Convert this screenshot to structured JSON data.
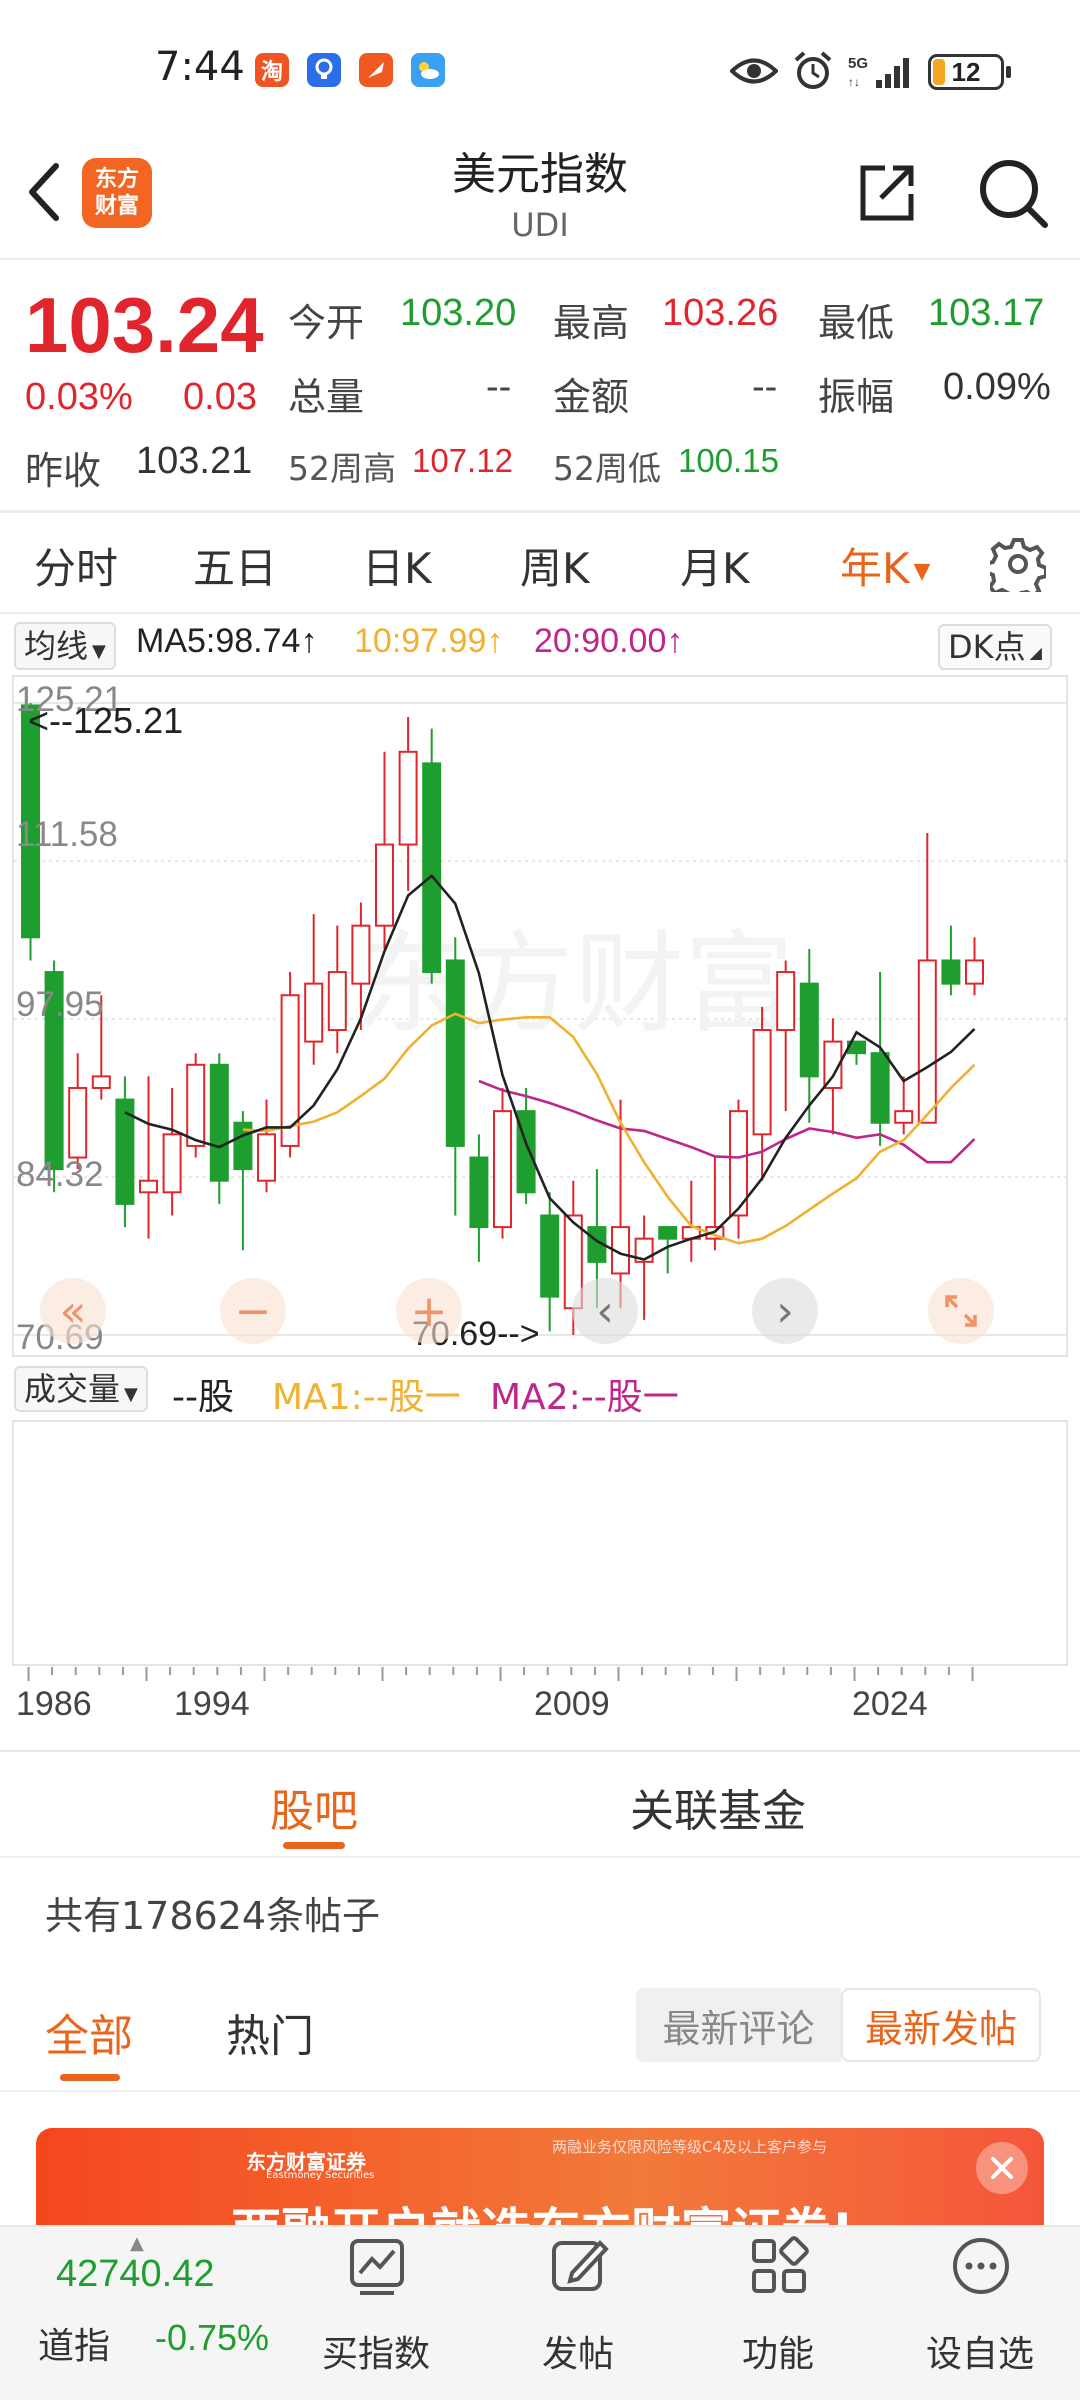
{
  "status_bar": {
    "time": "7:44",
    "network": "5G",
    "battery": "12",
    "icons": [
      "taobao-icon",
      "bulb-icon",
      "feather-icon",
      "weather-icon",
      "eye-icon",
      "alarm-icon",
      "signal-icon",
      "battery-icon"
    ]
  },
  "header": {
    "title": "美元指数",
    "subtitle": "UDI",
    "logo_text_1": "东方",
    "logo_text_2": "财富"
  },
  "quote": {
    "price": "103.24",
    "change_pct": "0.03%",
    "change": "0.03",
    "prev_close_label": "昨收",
    "prev_close": "103.21",
    "open_label": "今开",
    "open": "103.20",
    "high_label": "最高",
    "high": "103.26",
    "low_label": "最低",
    "low": "103.17",
    "volume_label": "总量",
    "volume": "--",
    "amount_label": "金额",
    "amount": "--",
    "amplitude_label": "振幅",
    "amplitude": "0.09%",
    "w52_high_label": "52周高",
    "w52_high": "107.12",
    "w52_low_label": "52周低",
    "w52_low": "100.15"
  },
  "period_tabs": [
    "分时",
    "五日",
    "日K",
    "周K",
    "月K",
    "年K"
  ],
  "active_period": "年K",
  "ma_bar": {
    "selector": "均线",
    "ma5": "MA5:98.74↑",
    "ma10": "10:97.99↑",
    "ma20": "20:90.00↑",
    "dk": "DK点"
  },
  "colors": {
    "up": "#e0262c",
    "down": "#1e9e2e",
    "ma5": "#222222",
    "ma10": "#f0b030",
    "ma20": "#c0268a",
    "accent": "#e8661c"
  },
  "chart_data": {
    "type": "candlestick",
    "y_ticks": [
      "125.21",
      "111.58",
      "97.95",
      "84.32",
      "70.69"
    ],
    "ylim": [
      70.69,
      125.21
    ],
    "x_ticks": [
      "1986",
      "1994",
      "2009",
      "2024"
    ],
    "max_label": "<--125.21",
    "min_label": "70.69-->",
    "candles": [
      {
        "o": 125,
        "c": 105,
        "h": 125.21,
        "l": 103
      },
      {
        "o": 102,
        "c": 85,
        "h": 103,
        "l": 83
      },
      {
        "o": 86,
        "c": 92,
        "h": 95,
        "l": 85
      },
      {
        "o": 92,
        "c": 93,
        "h": 100,
        "l": 91
      },
      {
        "o": 91,
        "c": 82,
        "h": 93,
        "l": 80
      },
      {
        "o": 83,
        "c": 84,
        "h": 93,
        "l": 79
      },
      {
        "o": 83,
        "c": 88,
        "h": 92,
        "l": 81
      },
      {
        "o": 87,
        "c": 94,
        "h": 95,
        "l": 86
      },
      {
        "o": 94,
        "c": 84,
        "h": 95,
        "l": 82
      },
      {
        "o": 89,
        "c": 85,
        "h": 90,
        "l": 78
      },
      {
        "o": 84,
        "c": 88,
        "h": 91,
        "l": 83
      },
      {
        "o": 87,
        "c": 100,
        "h": 102,
        "l": 86
      },
      {
        "o": 96,
        "c": 101,
        "h": 107,
        "l": 94
      },
      {
        "o": 97,
        "c": 102,
        "h": 106,
        "l": 95
      },
      {
        "o": 101,
        "c": 106,
        "h": 108,
        "l": 97
      },
      {
        "o": 106,
        "c": 113,
        "h": 121,
        "l": 104
      },
      {
        "o": 113,
        "c": 121,
        "h": 124,
        "l": 109
      },
      {
        "o": 120,
        "c": 102,
        "h": 123,
        "l": 101
      },
      {
        "o": 103,
        "c": 87,
        "h": 105,
        "l": 81
      },
      {
        "o": 86,
        "c": 80,
        "h": 88,
        "l": 77
      },
      {
        "o": 80,
        "c": 90,
        "h": 92,
        "l": 79
      },
      {
        "o": 90,
        "c": 83,
        "h": 92,
        "l": 82
      },
      {
        "o": 81,
        "c": 74,
        "h": 83,
        "l": 71
      },
      {
        "o": 73,
        "c": 81,
        "h": 84,
        "l": 70.69
      },
      {
        "o": 80,
        "c": 77,
        "h": 85,
        "l": 73
      },
      {
        "o": 76,
        "c": 80,
        "h": 91,
        "l": 73
      },
      {
        "o": 77,
        "c": 79,
        "h": 81,
        "l": 72
      },
      {
        "o": 80,
        "c": 79,
        "h": 80,
        "l": 76
      },
      {
        "o": 79,
        "c": 80,
        "h": 84,
        "l": 77
      },
      {
        "o": 79,
        "c": 80,
        "h": 86,
        "l": 78
      },
      {
        "o": 81,
        "c": 90,
        "h": 91,
        "l": 79
      },
      {
        "o": 88,
        "c": 97,
        "h": 99,
        "l": 84
      },
      {
        "o": 97,
        "c": 102,
        "h": 103,
        "l": 90
      },
      {
        "o": 101,
        "c": 93,
        "h": 104,
        "l": 89
      },
      {
        "o": 92,
        "c": 96,
        "h": 98,
        "l": 88
      },
      {
        "o": 96,
        "c": 95,
        "h": 96,
        "l": 94
      },
      {
        "o": 95,
        "c": 89,
        "h": 102,
        "l": 87
      },
      {
        "o": 89,
        "c": 90,
        "h": 93,
        "l": 88
      },
      {
        "o": 89,
        "c": 103,
        "h": 114,
        "l": 89
      },
      {
        "o": 103,
        "c": 101,
        "h": 106,
        "l": 100
      },
      {
        "o": 101,
        "c": 103,
        "h": 105,
        "l": 100
      }
    ],
    "ma5": [
      null,
      null,
      null,
      null,
      89.9,
      88.9,
      88.4,
      87.5,
      86.9,
      87.9,
      88.6,
      88.6,
      90.5,
      93.6,
      98,
      103.8,
      108.6,
      110.3,
      107.9,
      101.9,
      93.1,
      87.2,
      82.5,
      80.4,
      78.8,
      77.7,
      77.2,
      78.3,
      79.0,
      79.6,
      81.6,
      84.2,
      87.7,
      90.5,
      93.0,
      96.8,
      95.5,
      92.6,
      93.8,
      95.1,
      97.1
    ],
    "ma10": [
      null,
      null,
      null,
      null,
      null,
      null,
      null,
      null,
      null,
      88.4,
      88.3,
      88.7,
      89.1,
      89.9,
      91.3,
      92.8,
      95.4,
      97.4,
      98.4,
      97.6,
      97.9,
      98.1,
      98.1,
      96.4,
      93.2,
      89.0,
      85.6,
      82.6,
      80.1,
      79.3,
      78.6,
      79.0,
      80.1,
      81.5,
      82.9,
      84.2,
      86.5,
      87.5,
      89.7,
      92.0,
      94.0
    ],
    "ma20": [
      null,
      null,
      null,
      null,
      null,
      null,
      null,
      null,
      null,
      null,
      null,
      null,
      null,
      null,
      null,
      null,
      null,
      null,
      null,
      92.6,
      91.8,
      91.3,
      90.7,
      90.0,
      89.2,
      88.5,
      88.3,
      87.6,
      86.9,
      86.1,
      86.0,
      86.5,
      87.6,
      88.5,
      88.2,
      87.7,
      88.0,
      87.1,
      85.6,
      85.6,
      87.6
    ]
  },
  "volume_bar": {
    "selector": "成交量",
    "unit": "--股",
    "ma1": "MA1:--股一",
    "ma2": "MA2:--股一"
  },
  "section_tabs": [
    "股吧",
    "关联基金"
  ],
  "active_section": "股吧",
  "posts_count_text": "共有178624条帖子",
  "post_tabs": [
    "全部",
    "热门"
  ],
  "active_post_tab": "全部",
  "sort_options": [
    "最新评论",
    "最新发帖"
  ],
  "active_sort": "最新发帖",
  "banner": {
    "brand": "东方财富证券",
    "brand_en": "Eastmoney Securities",
    "notice": "两融业务仅限风险等级C4及以上客户参与",
    "headline": "两融开户就选东方财富证券!"
  },
  "bottom_nav": {
    "index_value": "42740.42",
    "index_name": "道指",
    "index_change": "-0.75%",
    "items": [
      "买指数",
      "发帖",
      "功能",
      "设自选"
    ]
  }
}
